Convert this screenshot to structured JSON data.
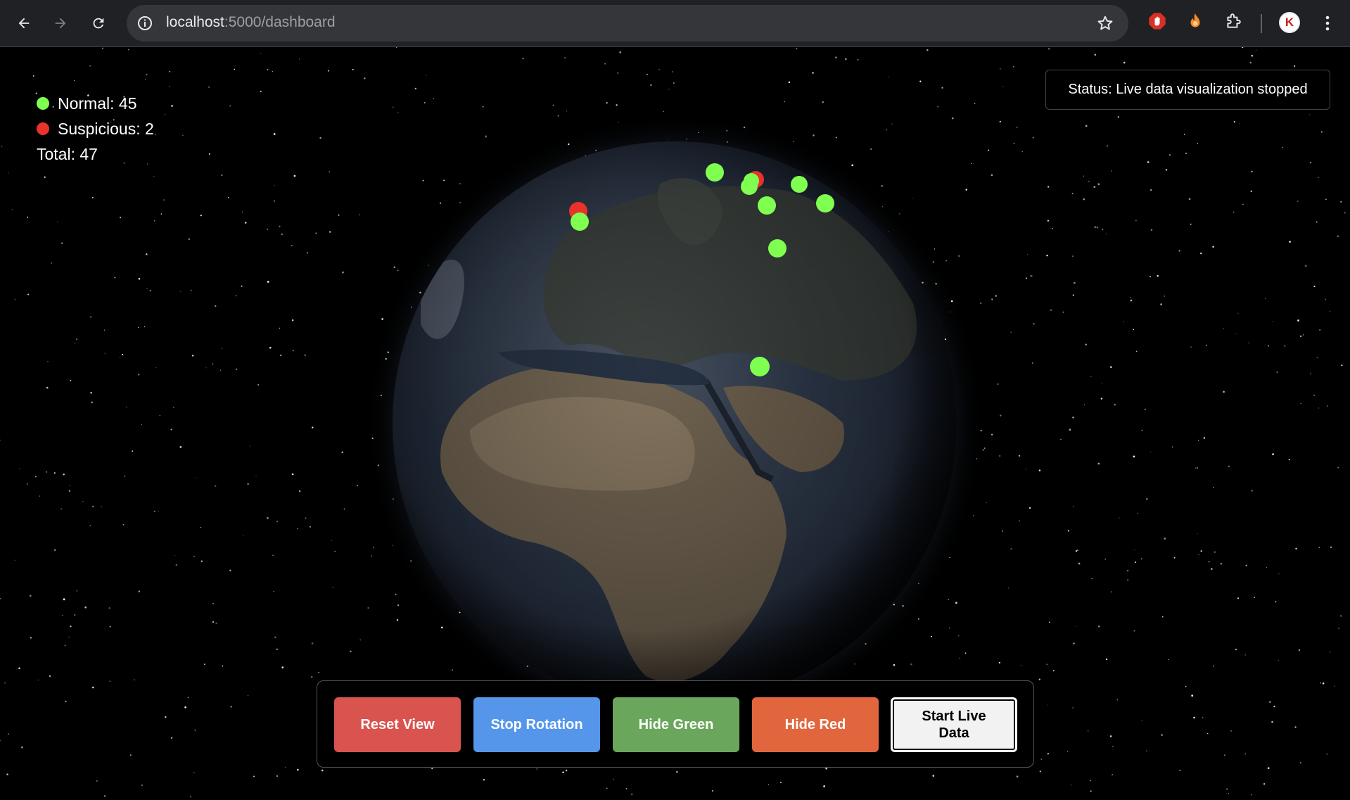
{
  "browser": {
    "url_host": "localhost",
    "url_path": ":5000/dashboard",
    "avatar_letter": "K",
    "icons": {
      "back": "arrow-left-icon",
      "forward": "arrow-right-icon",
      "reload": "reload-icon",
      "site_info": "info-icon",
      "bookmark": "star-icon",
      "extensions": [
        "adblock-hand-icon",
        "fire-extension-icon",
        "puzzle-extensions-icon"
      ],
      "menu": "kebab-menu-icon"
    }
  },
  "legend": {
    "normal_label": "Normal: 45",
    "suspicious_label": "Suspicious: 2",
    "total_label": "Total: 47",
    "normal_color": "#7fff50",
    "suspicious_color": "#e8322a"
  },
  "status": {
    "text": "Status: Live data visualization stopped"
  },
  "controls": {
    "reset_label": "Reset View",
    "rotation_label": "Stop Rotation",
    "hide_green_label": "Hide Green",
    "hide_red_label": "Hide Red",
    "live_label": "Start Live Data"
  },
  "colors": {
    "reset": "#d9534f",
    "rotation": "#5596ea",
    "hide_green": "#6aa65c",
    "hide_red": "#e2663d",
    "live": "#f2f2f2"
  }
}
